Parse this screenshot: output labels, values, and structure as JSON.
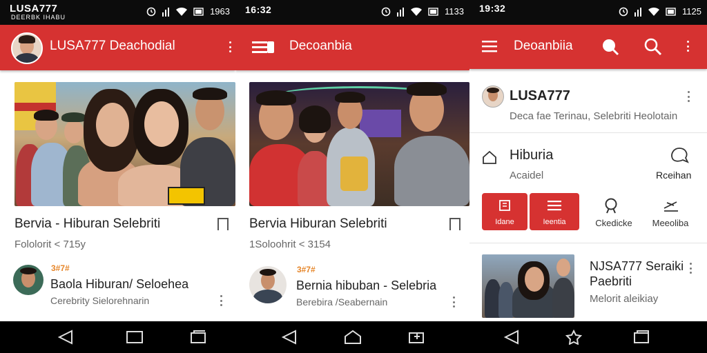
{
  "screen1": {
    "status": {
      "brand": "LUSA777",
      "sub": "DEERBK IHABU",
      "time": "1963"
    },
    "appbar": {
      "title": "LUSA777 Deachodial"
    },
    "card": {
      "title": "Bervia - Hiburan Selebriti",
      "meta": "Fololorit < 715y"
    },
    "list": [
      {
        "tag": "3#7#",
        "title": "Baola Hiburan/ Seloehea",
        "sub": "Cerebrity Sielorehnarin"
      }
    ]
  },
  "screen2": {
    "status": {
      "time_left": "16:32",
      "time": "1133"
    },
    "appbar": {
      "title": "Decoanbia"
    },
    "card": {
      "title": "Bervia Hiburan Selebriti",
      "meta": "1Soloohrit < 3154"
    },
    "list": [
      {
        "tag": "3#7#",
        "title": "Bernia hibuban - Selebria",
        "sub": "Berebira /Seabernain"
      }
    ]
  },
  "screen3": {
    "status": {
      "time_left": "19:32",
      "time": "1125"
    },
    "appbar": {
      "title": "Deoanbiia"
    },
    "profile": {
      "name": "LUSA777",
      "sub": "Deca fae Terinau, Selebriti Heolotain"
    },
    "section": {
      "title": "Hiburia",
      "sub": "Acaidel",
      "right_label": "Rceihan"
    },
    "actions": [
      "Idane",
      "Ieentia",
      "Ckedicke",
      "Meeoliba"
    ],
    "item": {
      "title": "NJSA777 Seraiki Paebriti",
      "sub": "Melorit aleikiay"
    }
  },
  "icons": [
    "alarm-icon",
    "signal-icon",
    "wifi-icon",
    "battery-icon",
    "menu-icon",
    "search-icon",
    "more-icon",
    "back-icon",
    "home-icon",
    "recents-icon",
    "bookmark-icon"
  ],
  "colors": {
    "brand_red": "#d63231",
    "status_bar": "#0c0c0c"
  }
}
